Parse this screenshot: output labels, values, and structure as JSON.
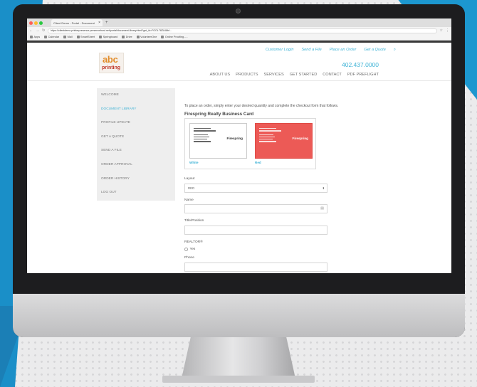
{
  "browser": {
    "tab_title": "Client Demo - Portal - Document",
    "url": "https://clientdemo.printerpresence.presencehost.net/portal/document-library.html?get_id=FOOL78ZL68bf...",
    "bookmarks": [
      "Apps",
      "Calendar",
      "Mail",
      "SmartSheet",
      "Springboard",
      "Drive",
      "VolunteerOne",
      "Online Proofing -..."
    ]
  },
  "site": {
    "logo": {
      "top": "abc",
      "bottom": "printing"
    },
    "utility_links": [
      "Customer Login",
      "Send a File",
      "Place an Order",
      "Get a Quote"
    ],
    "search_icon": "search-icon",
    "phone": "402.437.0000",
    "nav": [
      "ABOUT US",
      "PRODUCTS",
      "SERVICES",
      "GET STARTED",
      "CONTACT",
      "PDF PREFLIGHT"
    ]
  },
  "sidebar": {
    "items": [
      "WELCOME",
      "DOCUMENT LIBRARY",
      "PROFILE UPDATE",
      "GET A QUOTE",
      "SEND A FILE",
      "ORDER APPROVAL",
      "ORDER HISTORY",
      "LOG OUT"
    ],
    "active_index": 1
  },
  "main": {
    "intro": "To place an order, simply enter your desired quantity and complete the checkout form that follows.",
    "product_title": "Firespring Realty Business Card",
    "card_options": [
      {
        "label": "White",
        "logo": "Firespring"
      },
      {
        "label": "Red",
        "logo": "Firespring"
      }
    ],
    "layout": {
      "label": "Layout",
      "value": "RED"
    },
    "name": {
      "label": "Name",
      "value": ""
    },
    "title_position": {
      "label": "Title/Position",
      "value": ""
    },
    "realtor": {
      "label": "REALTOR®",
      "option": "Yes"
    },
    "phone": {
      "label": "Phone",
      "value": ""
    }
  },
  "colors": {
    "accent": "#3fb3d6",
    "brand_orange": "#e28d2c",
    "card_red": "#ec5a56",
    "background_blue": "#1c97cf"
  }
}
